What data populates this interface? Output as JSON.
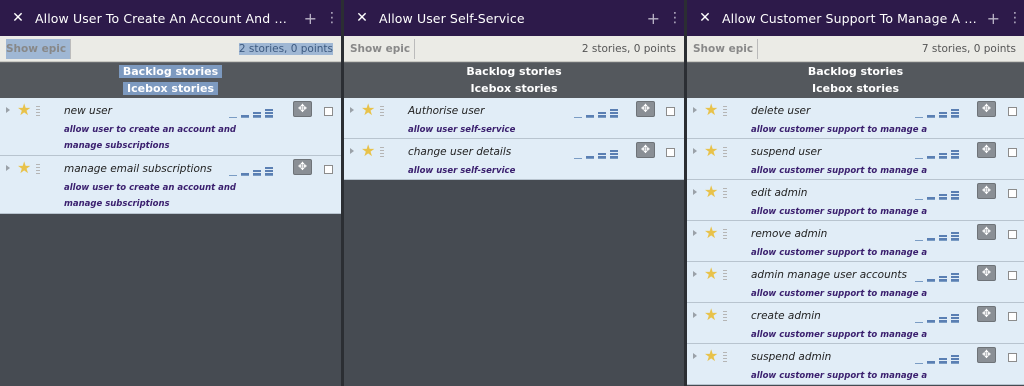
{
  "panels": [
    {
      "title": "Allow User To Create An Account And Manage S...",
      "show_epic": "Show epic",
      "count": "2 stories, 0 points",
      "backlog": "Backlog stories",
      "icebox": "Icebox stories",
      "stories": [
        {
          "name": "new user",
          "epic": "allow user to create an account and manage subscriptions"
        },
        {
          "name": "manage email subscriptions",
          "epic": "allow user to create an account and manage subscriptions"
        }
      ]
    },
    {
      "title": "Allow User Self-Service",
      "show_epic": "Show epic",
      "count": "2 stories, 0 points",
      "backlog": "Backlog stories",
      "icebox": "Icebox stories",
      "stories": [
        {
          "name": "Authorise user",
          "epic": "allow user self-service"
        },
        {
          "name": "change user details",
          "epic": "allow user self-service"
        }
      ]
    },
    {
      "title": "Allow Customer Support To Manage A User Acc...",
      "show_epic": "Show epic",
      "count": "7 stories, 0 points",
      "backlog": "Backlog stories",
      "icebox": "Icebox stories",
      "stories": [
        {
          "name": "delete user",
          "epic": "allow customer support to manage a user account"
        },
        {
          "name": "suspend user",
          "epic": "allow customer support to manage a user account"
        },
        {
          "name": "edit admin",
          "epic": "allow customer support to manage a user account"
        },
        {
          "name": "remove admin",
          "epic": "allow customer support to manage a user account"
        },
        {
          "name": "admin manage user accounts",
          "epic": "allow customer support to manage a user account"
        },
        {
          "name": "create admin",
          "epic": "allow customer support to manage a user account"
        },
        {
          "name": "suspend admin",
          "epic": "allow customer support to manage a user account"
        }
      ]
    }
  ],
  "icons": {
    "close": "close-icon",
    "plus": "plus-icon",
    "menu": "kebab-menu-icon",
    "star": "star-icon",
    "move": "move-icon"
  },
  "colors": {
    "header": "#2d1a4a",
    "story_bg": "#e1edf7",
    "epic_text": "#3a1f6e",
    "star": "#e8c24a",
    "selection": "#9fb7d4"
  }
}
